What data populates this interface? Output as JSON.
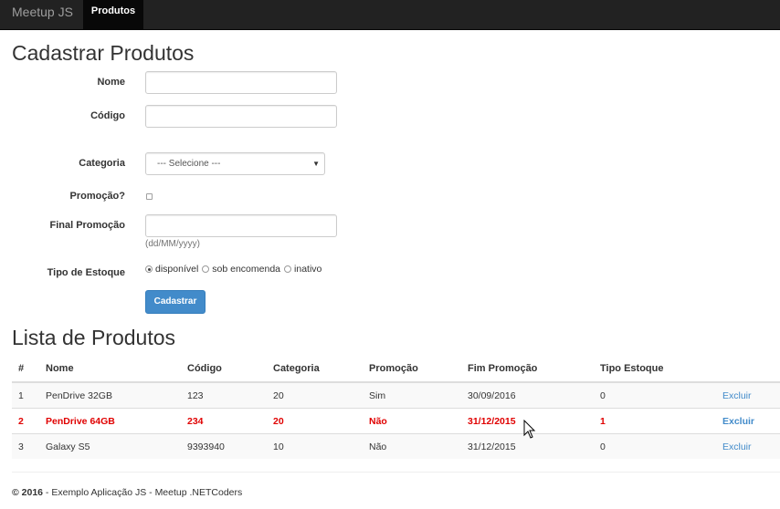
{
  "navbar": {
    "brand": "Meetup JS",
    "active_item": "Produtos"
  },
  "form": {
    "title": "Cadastrar Produtos",
    "nome_label": "Nome",
    "nome_value": "",
    "codigo_label": "Código",
    "codigo_value": "",
    "categoria_label": "Categoria",
    "categoria_selected": "--- Selecione ---",
    "promocao_label": "Promoção?",
    "final_promocao_label": "Final Promoção",
    "final_promocao_value": "",
    "final_promocao_help": "(dd/MM/yyyy)",
    "tipo_estoque_label": "Tipo de Estoque",
    "tipo_estoque_options": [
      "disponível",
      "sob encomenda",
      "inativo"
    ],
    "tipo_estoque_selected": "disponível",
    "submit_label": "Cadastrar"
  },
  "list": {
    "title": "Lista de Produtos",
    "columns": [
      "#",
      "Nome",
      "Código",
      "Categoria",
      "Promoção",
      "Fim Promoção",
      "Tipo Estoque",
      ""
    ],
    "rows": [
      {
        "id": "1",
        "nome": "PenDrive 32GB",
        "codigo": "123",
        "categoria": "20",
        "promocao": "Sim",
        "fim_promocao": "30/09/2016",
        "tipo_estoque": "0",
        "action": "Excluir"
      },
      {
        "id": "2",
        "nome": "PenDrive 64GB",
        "codigo": "234",
        "categoria": "20",
        "promocao": "Não",
        "fim_promocao": "31/12/2015",
        "tipo_estoque": "1",
        "action": "Excluir"
      },
      {
        "id": "3",
        "nome": "Galaxy S5",
        "codigo": "9393940",
        "categoria": "10",
        "promocao": "Não",
        "fim_promocao": "31/12/2015",
        "tipo_estoque": "0",
        "action": "Excluir"
      }
    ]
  },
  "footer": {
    "copyright": "© 2016",
    "text": " - Exemplo Aplicação JS - Meetup .NETCoders"
  },
  "colors": {
    "navbar": "#222222",
    "primary": "#428bca",
    "danger_row": "#e00000"
  }
}
